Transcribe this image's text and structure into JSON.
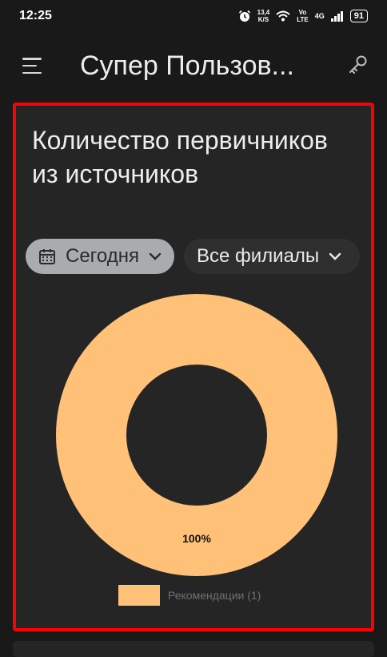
{
  "status": {
    "time": "12:25",
    "speed": "13,4",
    "speed_unit": "K/S",
    "volte_top": "Vo",
    "volte_bottom": "LTE",
    "network": "4G",
    "battery": "91"
  },
  "appbar": {
    "title": "Супер Пользов..."
  },
  "card": {
    "title": "Количество первичников из источников",
    "date_chip": "Сегодня",
    "branch_chip": "Все филиалы"
  },
  "chart_data": {
    "type": "pie",
    "donut": true,
    "categories": [
      "Рекомендации (1)"
    ],
    "values": [
      1
    ],
    "data_labels": [
      "100%"
    ],
    "colors": [
      "#ffc177"
    ],
    "legend": "bottom"
  }
}
